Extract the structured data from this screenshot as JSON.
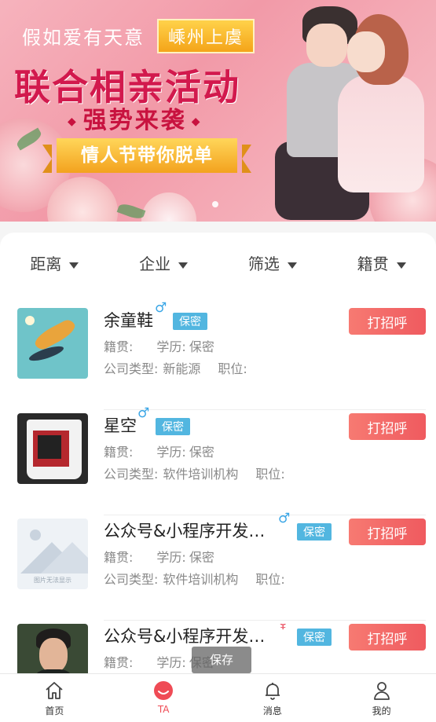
{
  "banner": {
    "script_text": "假如爱有天意",
    "tag": "嵊州上虞",
    "title": "联合相亲活动",
    "subtitle": "强势来袭",
    "ribbon": "情人节带你脱单"
  },
  "filters": [
    "距离",
    "企业",
    "筛选",
    "籍贯"
  ],
  "labels": {
    "origin": "籍贯:",
    "education": "学历:",
    "company_type": "公司类型:",
    "position": "职位:",
    "greet": "打招呼",
    "private": "保密"
  },
  "users": [
    {
      "name": "余童鞋",
      "gender_icon": "male-icon",
      "education": "保密",
      "company_type": "新能源"
    },
    {
      "name": "星空",
      "gender_icon": "male-icon",
      "education": "保密",
      "company_type": "软件培训机构"
    },
    {
      "name": "公众号&小程序开发…",
      "gender_icon": "male-icon",
      "education": "保密",
      "company_type": "软件培训机构",
      "avatar_caption": "图片无法显示"
    },
    {
      "name": "公众号&小程序开发…",
      "gender_icon": "female-icon",
      "education": "保密"
    }
  ],
  "toast": "保存",
  "tabbar": [
    "首页",
    "TA",
    "消息",
    "我的"
  ],
  "colors": {
    "accent": "#ef4b55",
    "badge": "#52b6e0",
    "male": "#3aa6e6",
    "female": "#ec5c6c"
  }
}
